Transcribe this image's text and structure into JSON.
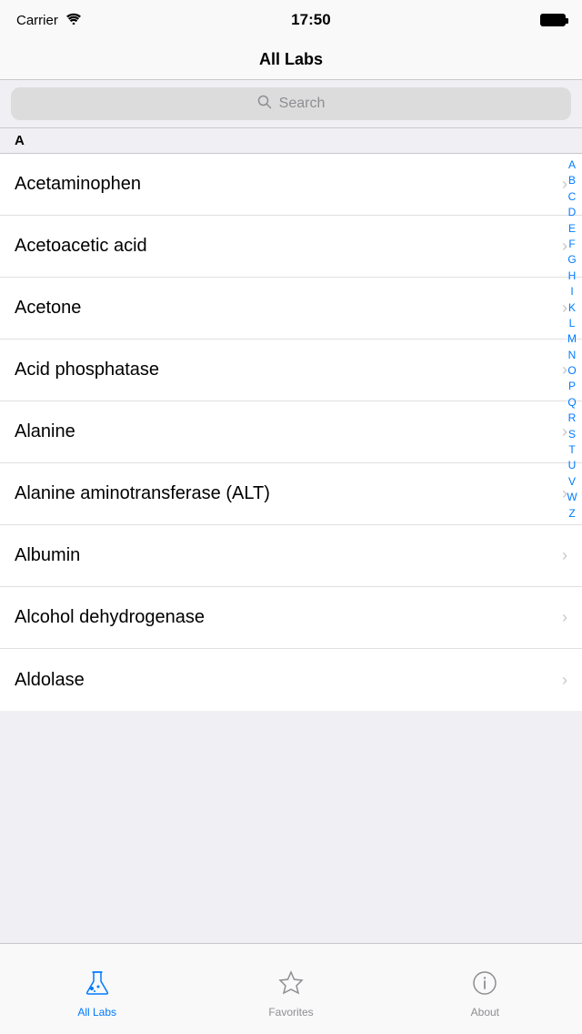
{
  "statusBar": {
    "carrier": "Carrier",
    "time": "17:50",
    "wifi": true,
    "battery": "full"
  },
  "navBar": {
    "title": "All Labs"
  },
  "search": {
    "placeholder": "Search"
  },
  "sectionHeaders": [
    {
      "letter": "A"
    }
  ],
  "listItems": [
    {
      "id": 1,
      "name": "Acetaminophen"
    },
    {
      "id": 2,
      "name": "Acetoacetic acid"
    },
    {
      "id": 3,
      "name": "Acetone"
    },
    {
      "id": 4,
      "name": "Acid phosphatase"
    },
    {
      "id": 5,
      "name": "Alanine"
    },
    {
      "id": 6,
      "name": "Alanine aminotransferase (ALT)"
    },
    {
      "id": 7,
      "name": "Albumin"
    },
    {
      "id": 8,
      "name": "Alcohol dehydrogenase"
    },
    {
      "id": 9,
      "name": "Aldolase"
    }
  ],
  "alphabetIndex": [
    "A",
    "B",
    "C",
    "D",
    "E",
    "F",
    "G",
    "H",
    "I",
    "K",
    "L",
    "M",
    "N",
    "O",
    "P",
    "Q",
    "R",
    "S",
    "T",
    "U",
    "V",
    "W",
    "Z"
  ],
  "tabBar": {
    "tabs": [
      {
        "id": "all-labs",
        "label": "All Labs",
        "active": true
      },
      {
        "id": "favorites",
        "label": "Favorites",
        "active": false
      },
      {
        "id": "about",
        "label": "About",
        "active": false
      }
    ]
  }
}
